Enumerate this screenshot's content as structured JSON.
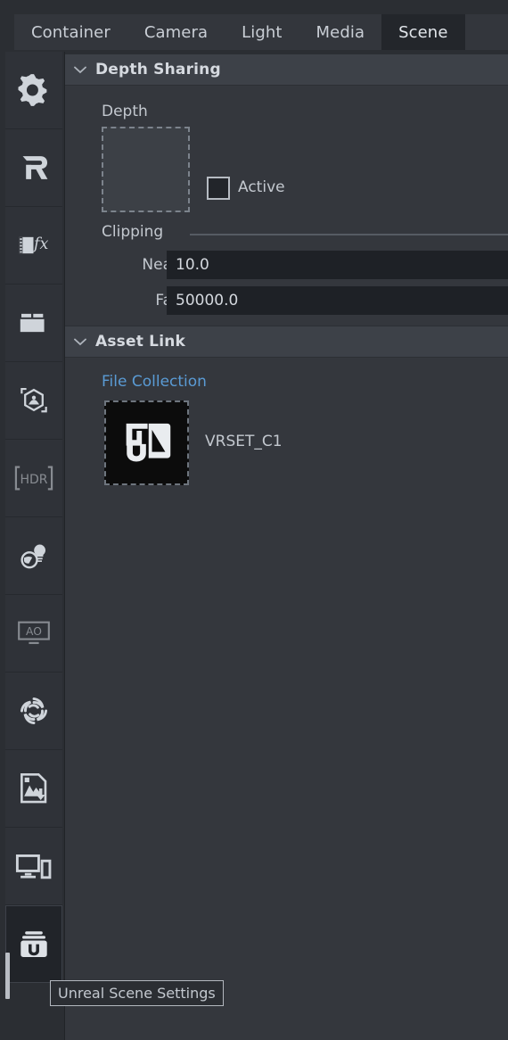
{
  "tabs": [
    {
      "label": "Container",
      "selected": false
    },
    {
      "label": "Camera",
      "selected": false
    },
    {
      "label": "Light",
      "selected": false
    },
    {
      "label": "Media",
      "selected": false
    },
    {
      "label": "Scene",
      "selected": true
    }
  ],
  "rail": {
    "items": [
      {
        "name": "settings-gear",
        "label": "Settings",
        "state": "normal"
      },
      {
        "name": "r-logo",
        "label": "R",
        "state": "normal"
      },
      {
        "name": "effects-fx",
        "label": "Effects",
        "state": "normal"
      },
      {
        "name": "toolbox",
        "label": "Toolbox",
        "state": "normal"
      },
      {
        "name": "object-tracking",
        "label": "Object Tracking",
        "state": "normal"
      },
      {
        "name": "hdr",
        "label": "HDR",
        "state": "dim"
      },
      {
        "name": "light-probe",
        "label": "Light Probe",
        "state": "normal"
      },
      {
        "name": "ambient-occlusion",
        "label": "AO",
        "state": "dim"
      },
      {
        "name": "lens-flare",
        "label": "Lens",
        "state": "normal"
      },
      {
        "name": "image-import",
        "label": "Import",
        "state": "normal"
      },
      {
        "name": "display-devices",
        "label": "Displays",
        "state": "normal"
      },
      {
        "name": "unreal-scene",
        "label": "Unreal Scene Settings",
        "state": "selected"
      }
    ]
  },
  "sections": {
    "depth_sharing": {
      "title": "Depth Sharing",
      "collapsed": false,
      "depth": {
        "label": "Depth",
        "dropzone_empty": true,
        "active": {
          "label": "Active",
          "checked": false
        }
      },
      "clipping": {
        "label": "Clipping",
        "near": {
          "label": "Near",
          "value": "10.0"
        },
        "far": {
          "label": "Far",
          "value": "50000.0"
        }
      }
    },
    "asset_link": {
      "title": "Asset Link",
      "collapsed": false,
      "file_collection": {
        "label": "File Collection",
        "asset": {
          "name": "VRSET_C1",
          "icon": "unreal-asset-icon"
        }
      }
    }
  },
  "tooltip": {
    "text": "Unreal Scene Settings"
  },
  "colors": {
    "panel_bg": "#34373d",
    "app_bg": "#2b2e33",
    "header_bg": "#3d4148",
    "tab_selected_bg": "#23262b",
    "input_bg": "#1e2126",
    "link": "#5a9bd5",
    "text": "#c3c8cf"
  }
}
